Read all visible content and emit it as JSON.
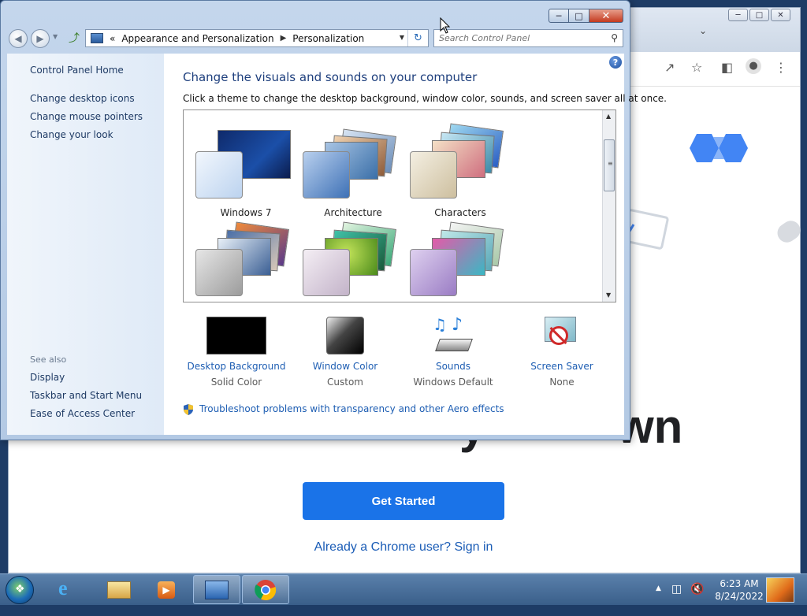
{
  "chrome_window": {
    "get_started_label": "Get Started",
    "signin_text": "Already a Chrome user? Sign in",
    "accent_color": "#1a73e8",
    "heading_visible_fragment_left": "y",
    "heading_visible_fragment_right": "wn"
  },
  "control_panel": {
    "breadcrumb": {
      "prefix": "«",
      "parts": [
        "Appearance and Personalization",
        "Personalization"
      ]
    },
    "search_placeholder": "Search Control Panel",
    "sidebar": {
      "home": "Control Panel Home",
      "links": [
        "Change desktop icons",
        "Change mouse pointers",
        "Change your look"
      ],
      "see_also_title": "See also",
      "see_also": [
        "Display",
        "Taskbar and Start Menu",
        "Ease of Access Center"
      ]
    },
    "heading": "Change the visuals and sounds on your computer",
    "subheading": "Click a theme to change the desktop background, window color, sounds, and screen saver all at once.",
    "themes": [
      {
        "label": "Windows 7"
      },
      {
        "label": "Architecture"
      },
      {
        "label": "Characters"
      },
      {
        "label": ""
      },
      {
        "label": ""
      },
      {
        "label": ""
      }
    ],
    "bottom": [
      {
        "title": "Desktop Background",
        "value": "Solid Color",
        "icon": "solid-black-swatch-icon"
      },
      {
        "title": "Window Color",
        "value": "Custom",
        "icon": "window-color-icon"
      },
      {
        "title": "Sounds",
        "value": "Windows Default",
        "icon": "sounds-icon"
      },
      {
        "title": "Screen Saver",
        "value": "None",
        "icon": "screen-saver-icon"
      }
    ],
    "troubleshoot_link": "Troubleshoot problems with transparency and other Aero effects"
  },
  "taskbar": {
    "time": "6:23 AM",
    "date": "8/24/2022"
  }
}
